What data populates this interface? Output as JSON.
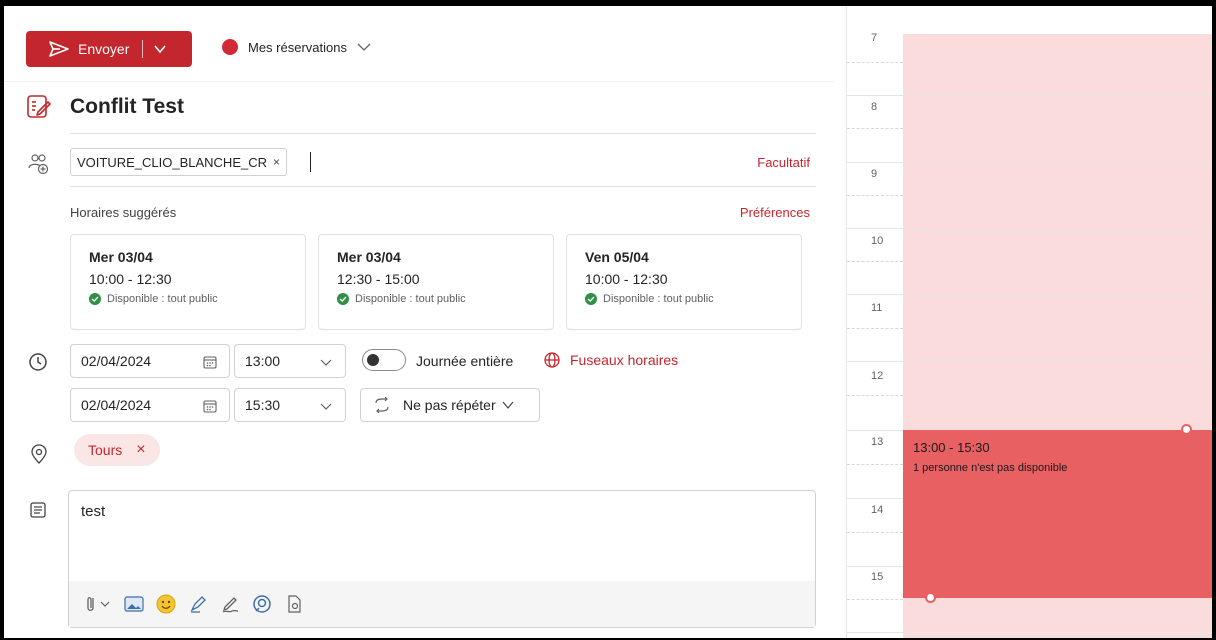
{
  "toolbar": {
    "send_label": "Envoyer",
    "calendar_label": "Mes réservations",
    "accent": "#c4262e"
  },
  "event": {
    "title": "Conflit Test"
  },
  "attendees": {
    "chip_label": "VOITURE_CLIO_BLANCHE_CR",
    "chip_remove": "×",
    "optional_label": "Facultatif"
  },
  "suggestions": {
    "title": "Horaires suggérés",
    "preferences_label": "Préférences",
    "cards": [
      {
        "date": "Mer 03/04",
        "time": "10:00 - 12:30",
        "availability": "Disponible : tout public"
      },
      {
        "date": "Mer 03/04",
        "time": "12:30 - 15:00",
        "availability": "Disponible : tout public"
      },
      {
        "date": "Ven 05/04",
        "time": "10:00 - 12:30",
        "availability": "Disponible : tout public"
      }
    ]
  },
  "schedule": {
    "start_date": "02/04/2024",
    "start_time": "13:00",
    "end_date": "02/04/2024",
    "end_time": "15:30",
    "all_day_label": "Journée entière",
    "all_day_on": false,
    "timezones_label": "Fuseaux horaires",
    "repeat_label": "Ne pas répéter"
  },
  "location": {
    "chip_label": "Tours",
    "chip_remove": "×"
  },
  "body": {
    "text": "test"
  },
  "editor_tools": [
    "attach-icon",
    "image-icon",
    "emoji-icon",
    "highlighter-icon",
    "signature-icon",
    "loop-icon",
    "sensitivity-icon"
  ],
  "calendar": {
    "hours": [
      "7",
      "8",
      "9",
      "10",
      "11",
      "12",
      "13",
      "14",
      "15"
    ],
    "event_time": "13:00 - 15:30",
    "event_status": "1 personne n'est pas disponible",
    "busy_color": "#e86062",
    "background_color": "#fbdcdc"
  }
}
